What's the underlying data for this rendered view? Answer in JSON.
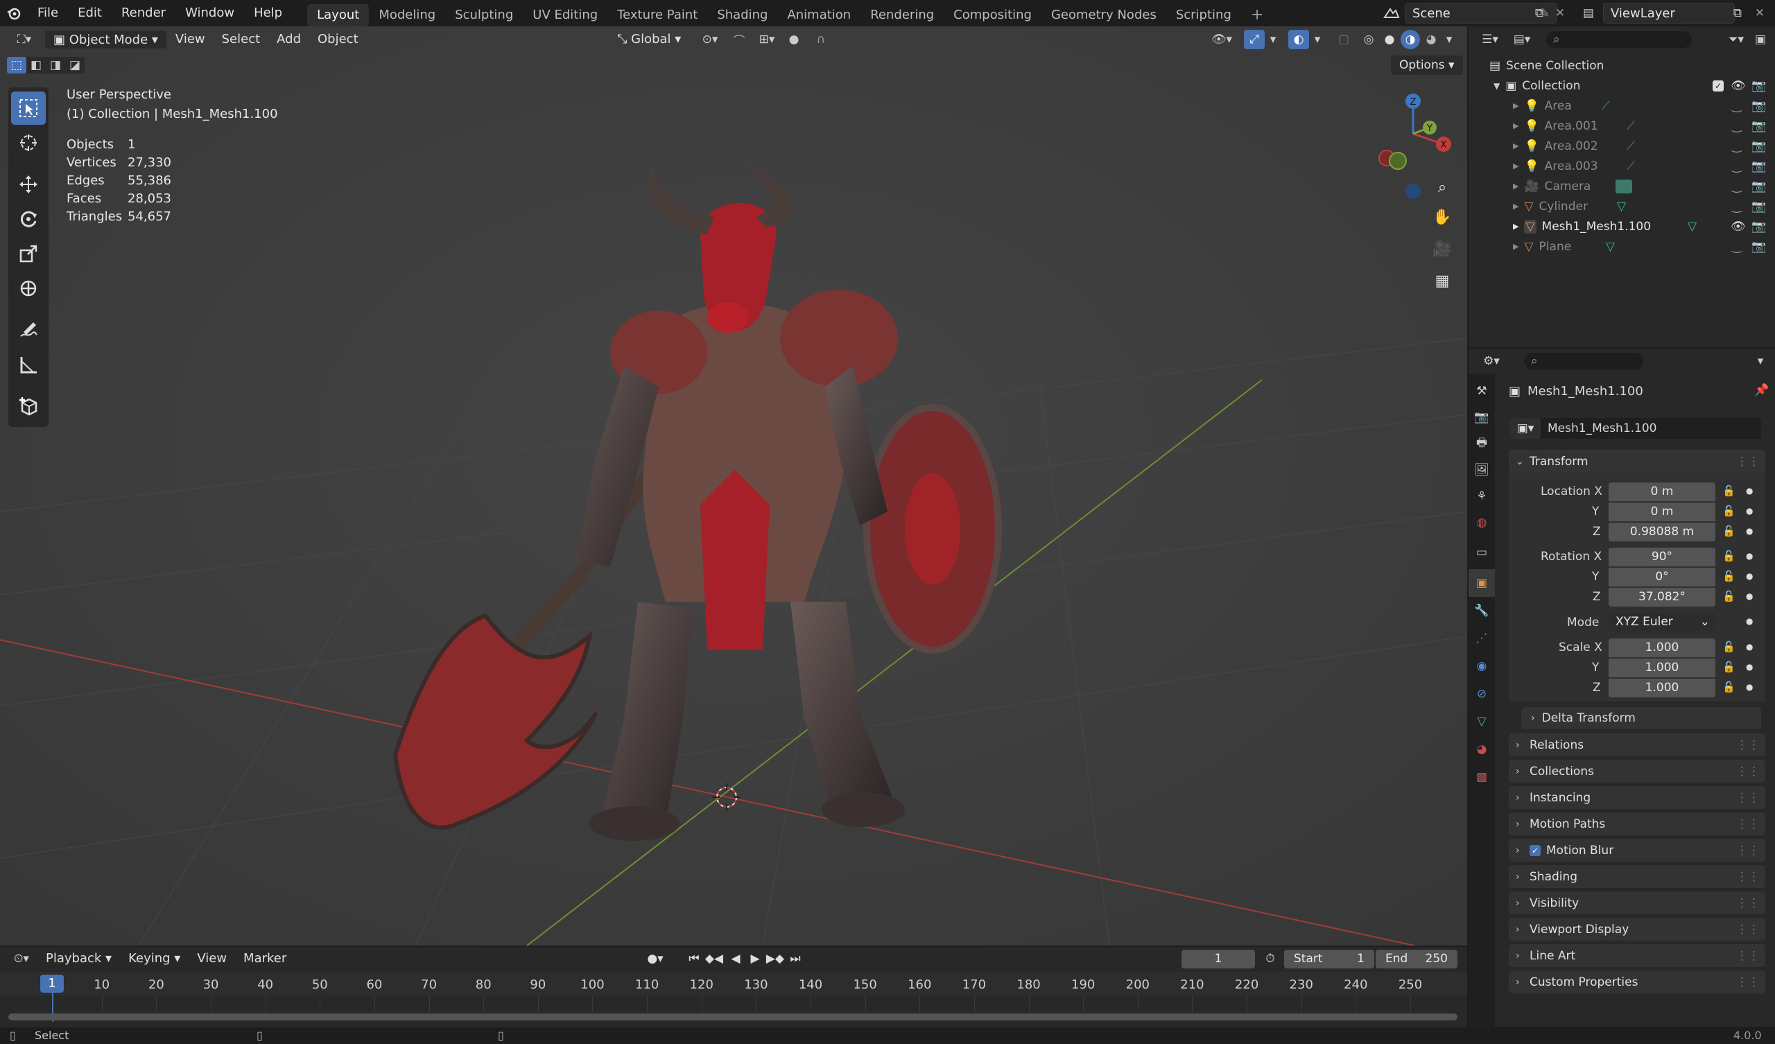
{
  "menu": {
    "blender_icon": "blender-logo-icon",
    "file": "File",
    "edit": "Edit",
    "render": "Render",
    "window": "Window",
    "help": "Help"
  },
  "workspaces": [
    "Layout",
    "Modeling",
    "Sculpting",
    "UV Editing",
    "Texture Paint",
    "Shading",
    "Animation",
    "Rendering",
    "Compositing",
    "Geometry Nodes",
    "Scripting"
  ],
  "scene": {
    "label": "Scene"
  },
  "viewlayer": {
    "label": "ViewLayer"
  },
  "viewport": {
    "mode": "Object Mode",
    "view": "View",
    "select": "Select",
    "add": "Add",
    "object": "Object",
    "transform_orientation": "Global",
    "options": "Options",
    "overlay_title": "User Perspective",
    "overlay_collection": "(1) Collection | Mesh1_Mesh1.100",
    "stats": [
      {
        "label": "Objects",
        "value": "1"
      },
      {
        "label": "Vertices",
        "value": "27,330"
      },
      {
        "label": "Edges",
        "value": "55,386"
      },
      {
        "label": "Faces",
        "value": "28,053"
      },
      {
        "label": "Triangles",
        "value": "54,657"
      }
    ],
    "gizmo": {
      "x": "X",
      "y": "Y",
      "z": "Z"
    }
  },
  "outliner": {
    "scene_collection": "Scene Collection",
    "collection": "Collection",
    "items": [
      {
        "label": "Area",
        "icon": "light-icon"
      },
      {
        "label": "Area.001",
        "icon": "light-icon"
      },
      {
        "label": "Area.002",
        "icon": "light-icon"
      },
      {
        "label": "Area.003",
        "icon": "light-icon"
      },
      {
        "label": "Camera",
        "icon": "camera-icon"
      },
      {
        "label": "Cylinder",
        "icon": "mesh-icon"
      },
      {
        "label": "Mesh1_Mesh1.100",
        "icon": "mesh-icon"
      },
      {
        "label": "Plane",
        "icon": "mesh-icon"
      }
    ]
  },
  "properties": {
    "object_name": "Mesh1_Mesh1.100",
    "object_field": "Mesh1_Mesh1.100",
    "transform_title": "Transform",
    "location_x_label": "Location X",
    "location_x": "0 m",
    "location_y_label": "Y",
    "location_y": "0 m",
    "location_z_label": "Z",
    "location_z": "0.98088 m",
    "rotation_x_label": "Rotation X",
    "rotation_x": "90°",
    "rotation_y_label": "Y",
    "rotation_y": "0°",
    "rotation_z_label": "Z",
    "rotation_z": "37.082°",
    "mode_label": "Mode",
    "mode": "XYZ Euler",
    "scale_x_label": "Scale X",
    "scale_x": "1.000",
    "scale_y_label": "Y",
    "scale_y": "1.000",
    "scale_z_label": "Z",
    "scale_z": "1.000",
    "delta_transform": "Delta Transform",
    "panels": [
      "Relations",
      "Collections",
      "Instancing",
      "Motion Paths",
      "Motion Blur",
      "Shading",
      "Visibility",
      "Viewport Display",
      "Line Art",
      "Custom Properties"
    ]
  },
  "timeline": {
    "playback": "Playback",
    "keying": "Keying",
    "view": "View",
    "marker": "Marker",
    "current_frame": "1",
    "start_label": "Start",
    "start": "1",
    "end_label": "End",
    "end": "250",
    "ticks": [
      "1",
      "10",
      "20",
      "30",
      "40",
      "50",
      "60",
      "70",
      "80",
      "90",
      "100",
      "110",
      "120",
      "130",
      "140",
      "150",
      "160",
      "170",
      "180",
      "190",
      "200",
      "210",
      "220",
      "230",
      "240",
      "250"
    ]
  },
  "status": {
    "select": "Select",
    "version": "4.0.0"
  },
  "colors": {
    "accent": "#4772b3",
    "x_axis": "#c43b3b",
    "y_axis": "#7fa23a",
    "z_axis": "#3b79c4",
    "mesh_red": "#b8202a"
  }
}
